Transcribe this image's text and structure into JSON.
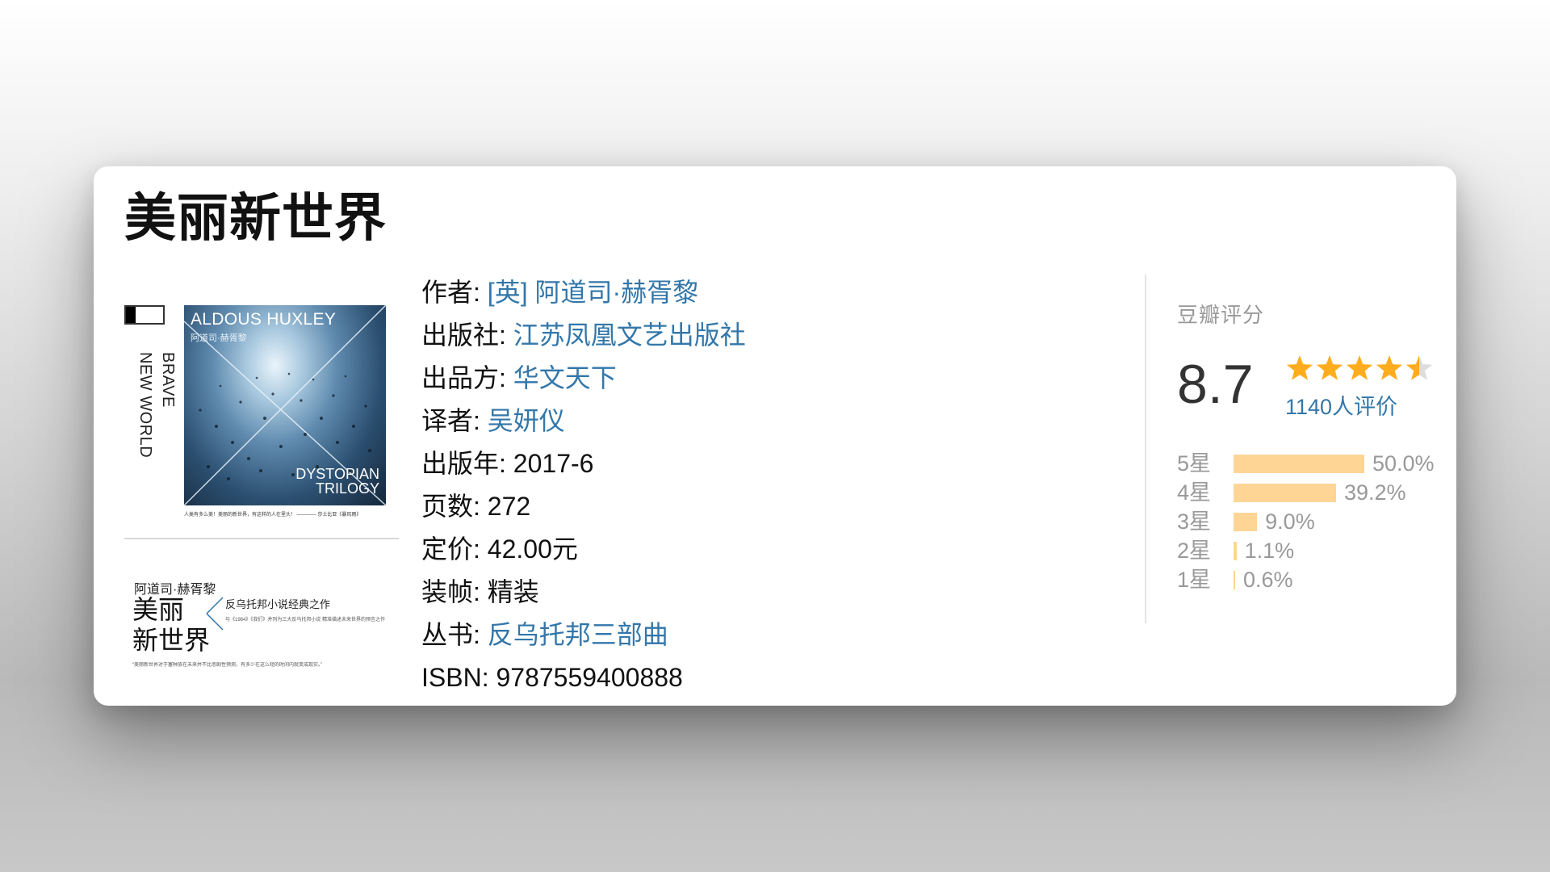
{
  "book": {
    "title": "美丽新世界"
  },
  "cover": {
    "author_en": "ALDOUS HUXLEY",
    "author_cn": "阿道司·赫胥黎",
    "spine_line1": "BRAVE",
    "spine_line2": "NEW WORLD",
    "trilogy_line1": "DYSTOPIAN",
    "trilogy_line2": "TRILOGY",
    "caption": "人类有多么美！美丽的新世界，有这样的人在里头！ ———— 莎士比亚《暴风雨》",
    "back_author": "阿道司·赫胥黎",
    "back_title_line1": "美丽",
    "back_title_line2": "新世界",
    "back_slogan": "反乌托邦小说经典之作",
    "back_small": "与《1984》《我们》并列为三大反乌托邦小说 精准描述未来世界的预言之作",
    "back_quote": "“美丽新世界对于塞种族在未来并不比悲剧性预测，有多少在这么短的时间内就变成现实。”"
  },
  "info": [
    {
      "label": "作者: ",
      "value": "[英] 阿道司·赫胥黎",
      "link": true
    },
    {
      "label": "出版社: ",
      "value": "江苏凤凰文艺出版社",
      "link": true
    },
    {
      "label": "出品方: ",
      "value": "华文天下",
      "link": true
    },
    {
      "label": "译者: ",
      "value": "吴妍仪",
      "link": true
    },
    {
      "label": "出版年: ",
      "value": "2017-6",
      "link": false
    },
    {
      "label": "页数: ",
      "value": "272",
      "link": false
    },
    {
      "label": "定价: ",
      "value": "42.00元",
      "link": false
    },
    {
      "label": "装帧: ",
      "value": "精装",
      "link": false
    },
    {
      "label": "丛书: ",
      "value": "反乌托邦三部曲",
      "link": true
    },
    {
      "label": "ISBN: ",
      "value": "9787559400888",
      "link": false
    }
  ],
  "rating": {
    "title": "豆瓣评分",
    "score": "8.7",
    "stars_out_of_5": 4.5,
    "votes": "1140人评价",
    "distribution": [
      {
        "label": "5星",
        "pct": "50.0%",
        "value": 50.0
      },
      {
        "label": "4星",
        "pct": "39.2%",
        "value": 39.2
      },
      {
        "label": "3星",
        "pct": "9.0%",
        "value": 9.0
      },
      {
        "label": "2星",
        "pct": "1.1%",
        "value": 1.1
      },
      {
        "label": "1星",
        "pct": "0.6%",
        "value": 0.6
      }
    ]
  },
  "colors": {
    "link": "#3377aa",
    "star": "#ffad1f",
    "star_empty": "#dddddd",
    "bar": "#ffd596",
    "muted": "#999999"
  }
}
